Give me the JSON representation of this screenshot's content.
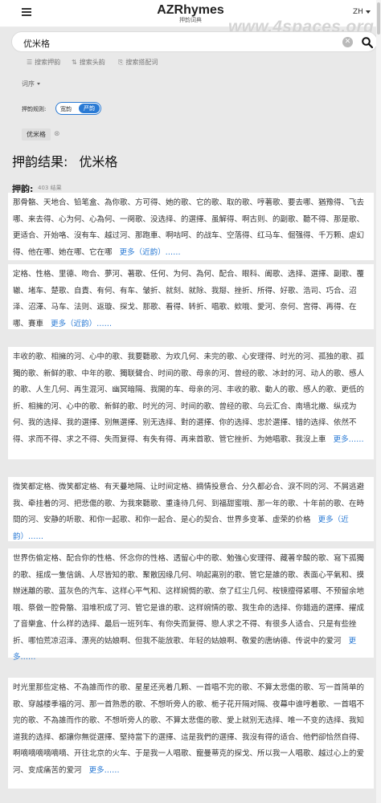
{
  "brand": {
    "title": "AZRhymes",
    "subtitle": "押韵词典"
  },
  "language": {
    "label": "ZH"
  },
  "watermark": "www.4spaces.org",
  "search": {
    "value": "优米格"
  },
  "modes": [
    {
      "icon": "☰",
      "label": "搜索押韵"
    },
    {
      "icon": "⇅",
      "label": "搜索头韵"
    },
    {
      "icon": "⎘",
      "label": "搜索搭配词"
    }
  ],
  "filter": {
    "label": "词序"
  },
  "rhyme_rule": {
    "label": "押韵规则:",
    "option_off": "宽韵",
    "option_on": "严韵"
  },
  "tag": {
    "label": "优米格",
    "close": "⊗"
  },
  "result": {
    "heading": "押韵结果:",
    "query": "优米格"
  },
  "subheading": {
    "label": "押韵:",
    "count": "403 结果"
  },
  "accent_color": "#2a7ad4",
  "blocks": [
    {
      "text": "那骨骼、天地合、铅笔盒、為你歌、方可得、她的歌、它的歌、取的歌、哼著歌、要去哪、猶豫得、飞去哪、来去得、心为何、心為何、一阕歌、没选择、的選擇、虽解得、啊古则、的副歌、聽不得、那是歌、更适合、开始咯、沒有车、越过河、那跑車、啊咕呵、的战车、空落得、红马车、倔强得、千万颗、虐幻得、他在哪、她在哪、它在哪",
      "more": "更多（近韵）……"
    },
    {
      "text": "定格、性格、里德、吻合、夢河、著歌、任何、为何、為何、配合、眼科、阖歌、选择、選擇、副歌、覆辙、堵车、楚歌、自責、有何、有车、皱折、就刻、就除、我搿、挫折、所得、好歌、浩司、巧合、沼泽、沼澤、马车、法则、返璇、探戈、那歌、看得、转折、唱歌、欸哦、愛河、奈何、宫得、再得、在哪、賽車",
      "more": "更多（近韵）……"
    },
    {
      "text": "丰收的歌、相擁的河、心中的歌、我要聽歌、为欢几何、未完的歌、心安理得、时光的河、孤独的歌、孤獨的歌、新鲜的歌、中年的歌、獨联聲合、时间的歌、母亲的河、曾经的歌、冰封的河、动人的歌、感人的歌、人生几何、再生混河、幽冥暗隔、我開的车、母亲的河、丰收的歌、動人的歌、感人的歌、更低的折、相擁的河、心中的歌、新鲜的歌、时光的河、时间的歌、曾经的歌、乌云汇合、南墙北撤、纵戎为何、我的选择、我的選擇、别無選擇、别无选择、對的選擇、你的选择、忠於選擇、错的选择、依然不得、求而不得、求之不得、失而复得、有失有得、再来首歌、管它挫折、为她唱歌、我沒上車",
      "more": "更多……"
    },
    {
      "text": "微笑都定格、微笑都定格、有天蔓地隔、让时间定格、摘情投意合、分久都必合、淚不同的河、不屑逃避我、牵挂着的河、把悲傷的歌、为我來聽歌、重逢待几何、到福甜蜜哦、那一年的歌、十年前的歌、在時間的河、安静的听歌、和你一起歌、和你一起合、是心的契合、世界多变革、虚荣的价格",
      "more": "更多（近韵）……"
    },
    {
      "text": "世界伤偷定格、配合你的性格、怀念你的性格、透留心中的歌、勉強心安理得、藏著辛酸的歌、寫下孤獨的歌、摇成一隻信鴿、人尽皆知的歌、聚散因缘几何、响起离别的歌、管它是誰的歌、表面心平氣和、摸辦迷離的歌、蓝灰色的汽车、这样心平气和、这样婉惆的歌、奈了红尘几何、桉镜擅得紧哪、不预留余地哦、祭做一腔骨骼、泪堆积成了河、管它是谁的歌、这样婉情的歌、我生命的选择、你錯過的選擇、擢成了音樂盒、什么样的选择、最后一班列车、有你失而复得、戀人求之不得、有很多人适合、只是有些挫折、哪怕荒凉沼泽、漂亮的姑娘啊、但我不能放歌、年轻的姑娘啊、敬爱的唐纳德、传说中的爱河",
      "more": "更多……"
    },
    {
      "text": "时光里那些定格、不為誰而作的歌、星星还亮着几颗、一首唱不完的歌、不算太悲傷的歌、写一首简单的歌、穿越楼季福的河、那一首熟悉的歌、不想听旁人的歌、栀子花开隔对隔、夜幕中谁哼着歌、一首唱不完的歌、不為誰而作的歌、不想听旁人的歌、不算太悲傷的歌、愛上就別无选择、唯一不变的选择、我知道我的选择、都讓你無從選擇、堅持當下的選擇、這是我們的選擇、我沒有得的适合、他們卻恰然自得、啊嘀嘀嘀嘀嘀嘀、开往北京的火车、于是我一人唱歌、寵曼蒂克的探戈、所以我一人唱歌、越过心上的爱河、变成痛苦的爱河",
      "more": "更多……"
    }
  ]
}
